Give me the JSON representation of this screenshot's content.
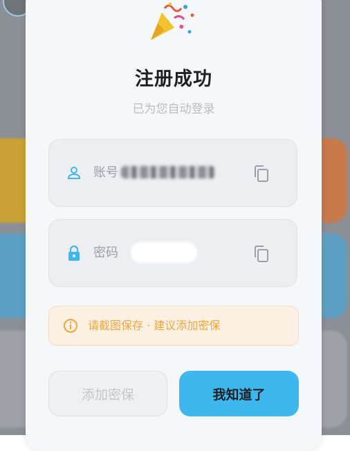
{
  "dialog": {
    "title": "注册成功",
    "subtitle": "已为您自动登录"
  },
  "account_field": {
    "label": "账号",
    "value": "",
    "icon": "user-icon"
  },
  "password_field": {
    "label": "密码",
    "value": "",
    "icon": "lock-icon"
  },
  "notice": {
    "text": "请截图保存 · 建议添加密保",
    "icon": "info-icon"
  },
  "buttons": {
    "secondary_label": "添加密保",
    "primary_label": "我知道了"
  },
  "colors": {
    "accent": "#3eb6ee",
    "warning": "#f0a637"
  }
}
